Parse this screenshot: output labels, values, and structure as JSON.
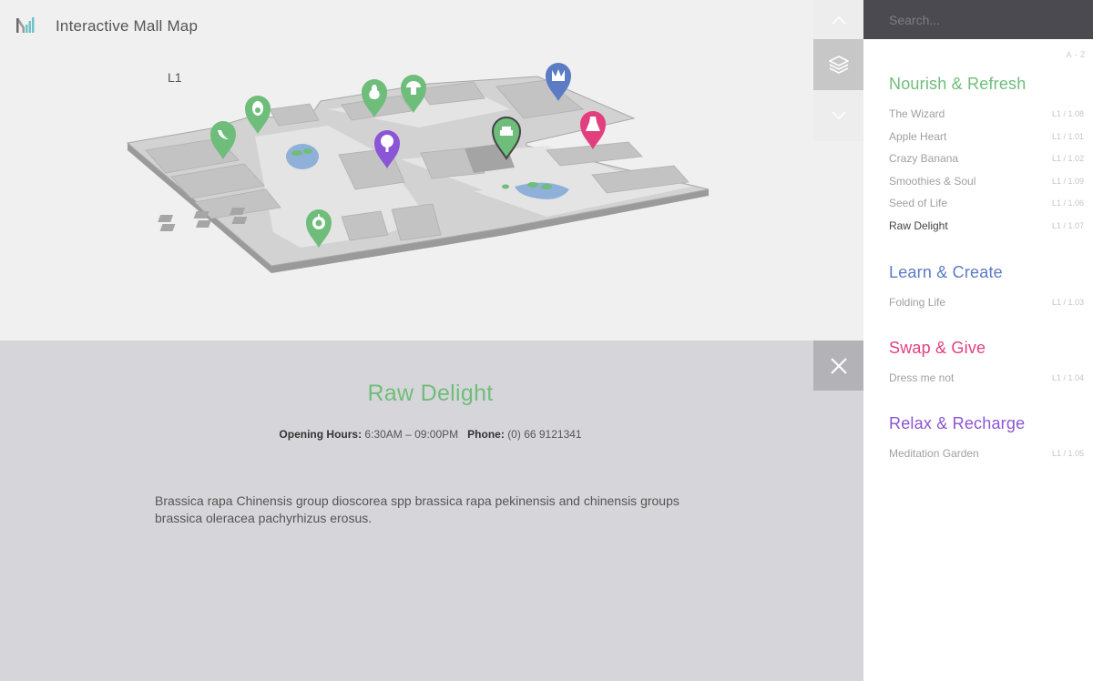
{
  "header": {
    "title": "Interactive Mall Map"
  },
  "map": {
    "level": "L1"
  },
  "pins": [
    {
      "name": "banana-pin",
      "color": "#6fbd7a",
      "icon": "banana-icon"
    },
    {
      "name": "avocado-pin",
      "color": "#6fbd7a",
      "icon": "avocado-icon"
    },
    {
      "name": "pear-pin",
      "color": "#6fbd7a",
      "icon": "pear-icon"
    },
    {
      "name": "mushroom-pin",
      "color": "#6fbd7a",
      "icon": "mushroom-icon"
    },
    {
      "name": "crown-pin",
      "color": "#5b7bc4",
      "icon": "crown-icon"
    },
    {
      "name": "cake-pin",
      "color": "#6fbd7a",
      "icon": "cake-icon"
    },
    {
      "name": "dress-pin",
      "color": "#e33f7e",
      "icon": "dress-icon"
    },
    {
      "name": "tree-pin",
      "color": "#8a55d6",
      "icon": "tree-icon"
    },
    {
      "name": "apple-pin",
      "color": "#6fbd7a",
      "icon": "apple-icon"
    }
  ],
  "controls": {
    "up": "chevron-up-icon",
    "layers": "layers-icon",
    "down": "chevron-down-icon"
  },
  "detail": {
    "title": "Raw Delight",
    "hours_label": "Opening Hours:",
    "hours_value": "6:30AM – 09:00PM",
    "phone_label": "Phone:",
    "phone_value": "(0) 66 9121341",
    "description": "Brassica rapa Chinensis group dioscorea spp brassica rapa pekinensis and chinensis groups brassica oleracea pachyrhizus erosus."
  },
  "sidebar": {
    "search_placeholder": "Search...",
    "sort_label": "A - Z",
    "categories": [
      {
        "title": "Nourish & Refresh",
        "color": "#6fbd7a",
        "items": [
          {
            "name": "The Wizard",
            "location": "L1 / 1.08"
          },
          {
            "name": "Apple Heart",
            "location": "L1 / 1.01"
          },
          {
            "name": "Crazy Banana",
            "location": "L1 / 1.02"
          },
          {
            "name": "Smoothies & Soul",
            "location": "L1 / 1.09"
          },
          {
            "name": "Seed of Life",
            "location": "L1 / 1.06"
          },
          {
            "name": "Raw Delight",
            "location": "L1 / 1.07"
          }
        ]
      },
      {
        "title": "Learn & Create",
        "color": "#5b7bc4",
        "items": [
          {
            "name": "Folding Life",
            "location": "L1 / 1.03"
          }
        ]
      },
      {
        "title": "Swap & Give",
        "color": "#e33f7e",
        "items": [
          {
            "name": "Dress me not",
            "location": "L1 / 1.04"
          }
        ]
      },
      {
        "title": "Relax & Recharge",
        "color": "#8a55d6",
        "items": [
          {
            "name": "Meditation Garden",
            "location": "L1 / 1.05"
          }
        ]
      }
    ]
  }
}
